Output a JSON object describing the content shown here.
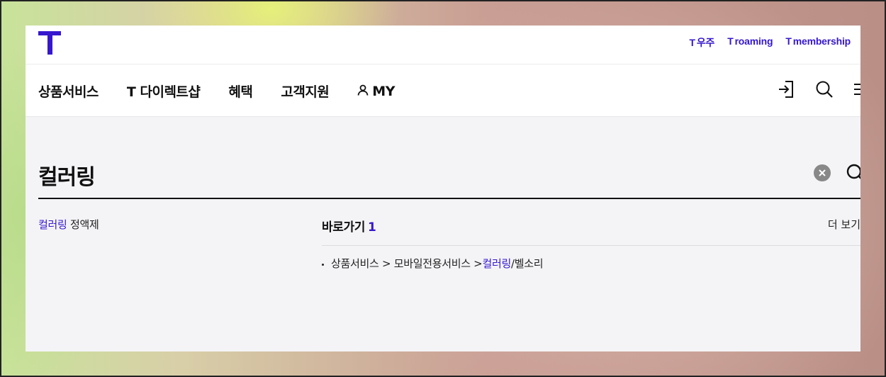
{
  "header": {
    "logo_letter": "T",
    "util_links": [
      {
        "prefix": "T",
        "label": "우주"
      },
      {
        "prefix": "T",
        "label": "roaming"
      },
      {
        "prefix": "T",
        "label": "membership"
      }
    ]
  },
  "nav": {
    "items": [
      "상품서비스",
      "T 다이렉트샵",
      "혜택",
      "고객지원",
      "MY"
    ],
    "icons": [
      "login-icon",
      "search-icon",
      "menu-icon"
    ]
  },
  "search": {
    "query": "컬러링",
    "clear_icon": "close-circle-icon",
    "search_icon": "search-icon"
  },
  "suggestion": {
    "highlight": "컬러링",
    "rest": " 정액제"
  },
  "shortcut": {
    "title": "바로가기",
    "count": "1",
    "more_label": "더 보기",
    "results": [
      {
        "before": "상품서비스 > 모바일전용서비스 > ",
        "highlight": "컬러링",
        "after": "/벨소리"
      }
    ]
  },
  "colors": {
    "brand": "#3617ce",
    "panel_bg": "#f4f4f7"
  }
}
